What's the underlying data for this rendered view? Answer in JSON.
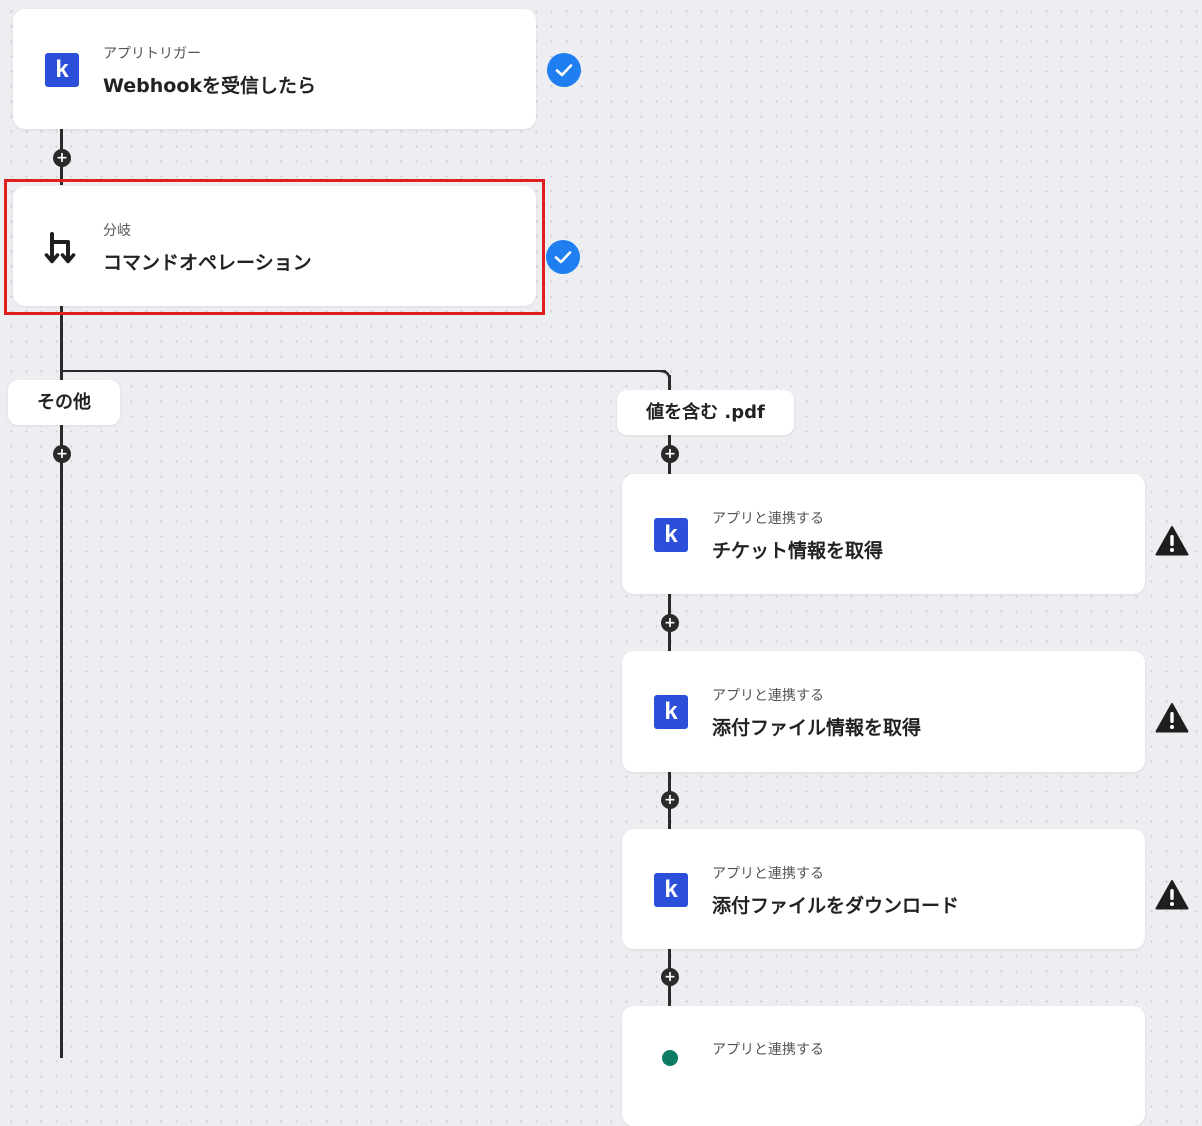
{
  "steps": {
    "trigger": {
      "subtitle": "アプリトリガー",
      "title": "Webhookを受信したら",
      "icon": "k-app-icon",
      "status": "completed"
    },
    "branch": {
      "subtitle": "分岐",
      "title": "コマンドオペレーション",
      "icon": "branch-icon",
      "status": "completed"
    },
    "get_ticket": {
      "subtitle": "アプリと連携する",
      "title": "チケット情報を取得",
      "icon": "k-app-icon",
      "status": "warning"
    },
    "get_attachment": {
      "subtitle": "アプリと連携する",
      "title": "添付ファイル情報を取得",
      "icon": "k-app-icon",
      "status": "warning"
    },
    "download_attachment": {
      "subtitle": "アプリと連携する",
      "title": "添付ファイルをダウンロード",
      "icon": "k-app-icon",
      "status": "warning"
    },
    "next_step": {
      "subtitle": "アプリと連携する",
      "icon": "green-app-icon"
    }
  },
  "branches": {
    "other": "その他",
    "contains": "値を含む .pdf"
  },
  "icons": {
    "app_letter": "k",
    "plus": "+"
  },
  "colors": {
    "app_brand": "#2b4fd8",
    "check": "#1f7ff0",
    "highlight": "#e02020",
    "warning": "#1e1e1e",
    "canvas": "#eceef1"
  }
}
